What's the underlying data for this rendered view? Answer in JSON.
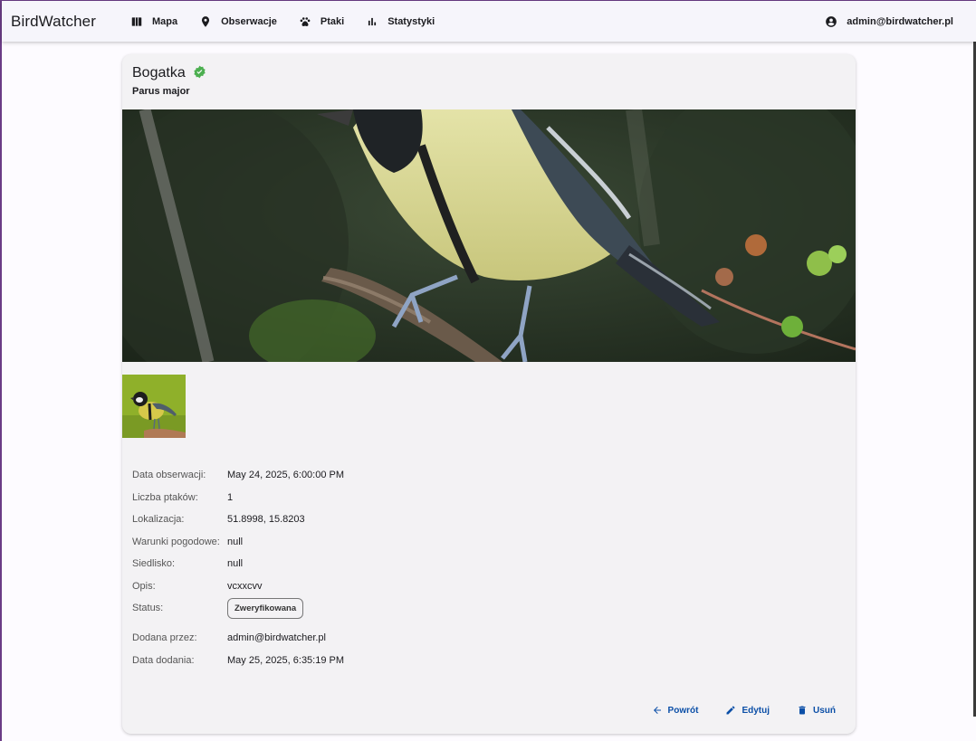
{
  "app": {
    "brand": "BirdWatcher"
  },
  "nav": [
    {
      "label": "Mapa",
      "icon": "map-icon"
    },
    {
      "label": "Obserwacje",
      "icon": "pin-icon"
    },
    {
      "label": "Ptaki",
      "icon": "paw-icon"
    },
    {
      "label": "Statystyki",
      "icon": "bar-chart-icon"
    }
  ],
  "user": {
    "email": "admin@birdwatcher.pl",
    "icon": "account-circle-icon"
  },
  "observation": {
    "species_name": "Bogatka",
    "latin_name": "Parus major",
    "verified_icon": "verified-icon",
    "verified_color": "#4caf50",
    "fields": [
      {
        "label": "Data obserwacji:",
        "value": "May 24, 2025, 6:00:00 PM"
      },
      {
        "label": "Liczba ptaków:",
        "value": "1"
      },
      {
        "label": "Lokalizacja:",
        "value": "51.8998, 15.8203"
      },
      {
        "label": "Warunki pogodowe:",
        "value": "null"
      },
      {
        "label": "Siedlisko:",
        "value": "null"
      },
      {
        "label": "Opis:",
        "value": "vcxxcvv"
      },
      {
        "label": "Status:",
        "value": "Zweryfikowana"
      },
      {
        "label": "Dodana przez:",
        "value": "admin@birdwatcher.pl"
      },
      {
        "label": "Data dodania:",
        "value": "May 25, 2025, 6:35:19 PM"
      }
    ]
  },
  "actions": {
    "back": {
      "label": "Powrót",
      "icon": "arrow-left-icon"
    },
    "edit": {
      "label": "Edytuj",
      "icon": "pencil-icon"
    },
    "delete": {
      "label": "Usuń",
      "icon": "trash-icon"
    }
  },
  "colors": {
    "accent": "#0b4fa7",
    "card": "#f3f2f4",
    "toolbar": "#f6f5fb"
  }
}
